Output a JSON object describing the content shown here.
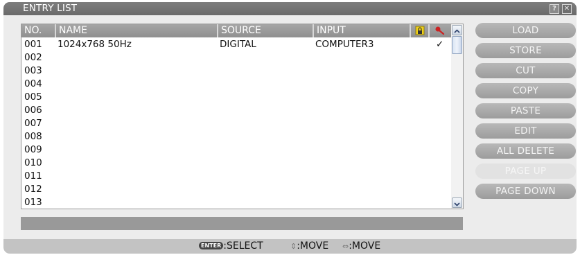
{
  "window": {
    "title": "ENTRY LIST",
    "help_label": "?",
    "close_label": "✕"
  },
  "table": {
    "columns": [
      "NO.",
      "NAME",
      "SOURCE",
      "INPUT"
    ],
    "icon_columns": [
      "lock-icon",
      "adjust-icon"
    ],
    "rows": [
      {
        "no": "001",
        "name": "1024x768 50Hz",
        "source": "DIGITAL",
        "input": "COMPUTER3",
        "check": "✓"
      },
      {
        "no": "002",
        "name": "",
        "source": "",
        "input": "",
        "check": ""
      },
      {
        "no": "003",
        "name": "",
        "source": "",
        "input": "",
        "check": ""
      },
      {
        "no": "004",
        "name": "",
        "source": "",
        "input": "",
        "check": ""
      },
      {
        "no": "005",
        "name": "",
        "source": "",
        "input": "",
        "check": ""
      },
      {
        "no": "006",
        "name": "",
        "source": "",
        "input": "",
        "check": ""
      },
      {
        "no": "007",
        "name": "",
        "source": "",
        "input": "",
        "check": ""
      },
      {
        "no": "008",
        "name": "",
        "source": "",
        "input": "",
        "check": ""
      },
      {
        "no": "009",
        "name": "",
        "source": "",
        "input": "",
        "check": ""
      },
      {
        "no": "010",
        "name": "",
        "source": "",
        "input": "",
        "check": ""
      },
      {
        "no": "011",
        "name": "",
        "source": "",
        "input": "",
        "check": ""
      },
      {
        "no": "012",
        "name": "",
        "source": "",
        "input": "",
        "check": ""
      },
      {
        "no": "013",
        "name": "",
        "source": "",
        "input": "",
        "check": ""
      }
    ]
  },
  "buttons": [
    {
      "label": "LOAD",
      "name": "load-button",
      "enabled": true
    },
    {
      "label": "STORE",
      "name": "store-button",
      "enabled": true
    },
    {
      "label": "CUT",
      "name": "cut-button",
      "enabled": true
    },
    {
      "label": "COPY",
      "name": "copy-button",
      "enabled": true
    },
    {
      "label": "PASTE",
      "name": "paste-button",
      "enabled": true
    },
    {
      "label": "EDIT",
      "name": "edit-button",
      "enabled": true
    },
    {
      "label": "ALL DELETE",
      "name": "all-delete-button",
      "enabled": true
    },
    {
      "label": "PAGE UP",
      "name": "page-up-button",
      "enabled": false
    },
    {
      "label": "PAGE DOWN",
      "name": "page-down-button",
      "enabled": true
    }
  ],
  "footer": {
    "enter_key": "ENTER",
    "select_label": ":SELECT",
    "updown_label": ":MOVE",
    "leftright_label": ":MOVE"
  },
  "colors": {
    "header": "#999999",
    "button": "#aaaaaa",
    "button_disabled": "#e2e2e2",
    "lock_icon": "#f2d21a",
    "adjust_icon": "#cc2222"
  }
}
